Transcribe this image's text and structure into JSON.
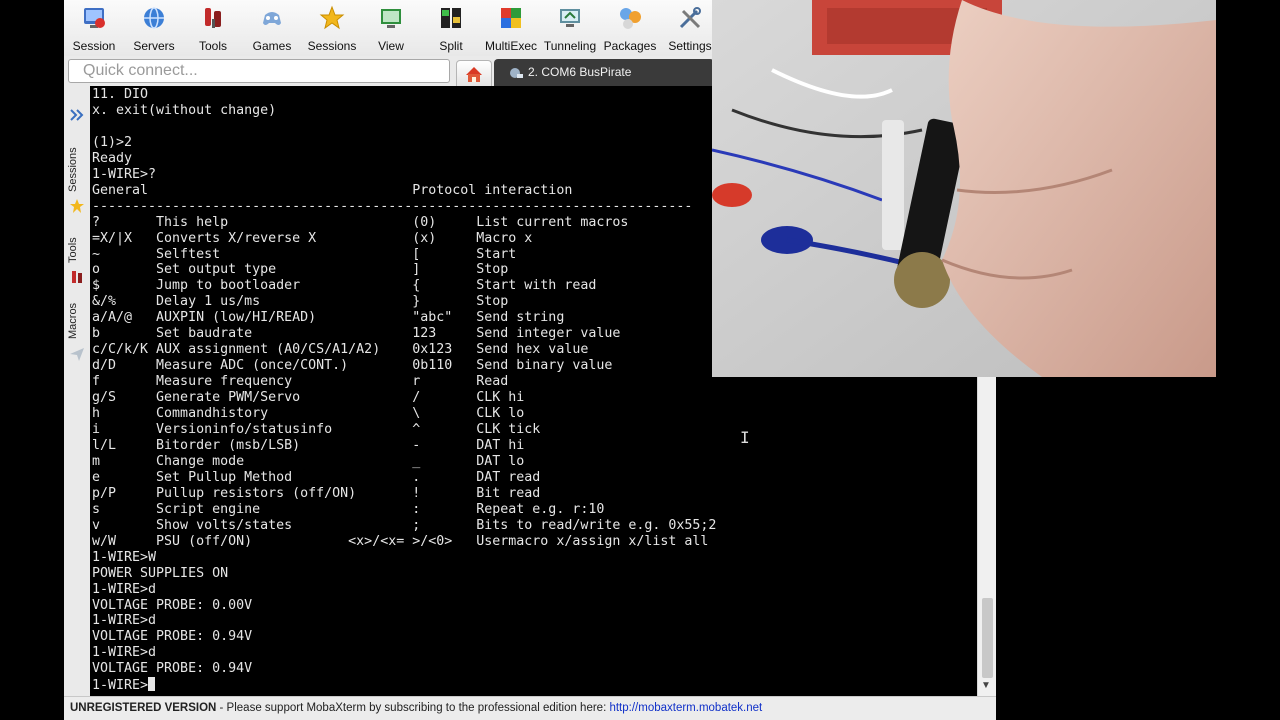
{
  "toolbar": {
    "buttons": [
      {
        "label": "Session",
        "icon": "session-icon"
      },
      {
        "label": "Servers",
        "icon": "servers-icon"
      },
      {
        "label": "Tools",
        "icon": "tools-icon"
      },
      {
        "label": "Games",
        "icon": "games-icon"
      },
      {
        "label": "Sessions",
        "icon": "sessions-star-icon"
      },
      {
        "label": "View",
        "icon": "view-icon"
      },
      {
        "label": "Split",
        "icon": "split-icon"
      },
      {
        "label": "MultiExec",
        "icon": "multiexec-icon"
      },
      {
        "label": "Tunneling",
        "icon": "tunneling-icon"
      },
      {
        "label": "Packages",
        "icon": "packages-icon"
      },
      {
        "label": "Settings",
        "icon": "settings-icon"
      }
    ]
  },
  "quick_connect": {
    "placeholder": "Quick connect..."
  },
  "tabs": {
    "home_icon": "home-icon",
    "active": {
      "label": "2. COM6 BusPirate",
      "icon": "serial-session-icon"
    }
  },
  "sidebar": {
    "tabs": [
      {
        "label": "Sessions",
        "icon": "star-icon"
      },
      {
        "label": "Tools",
        "icon": "tools-icon"
      },
      {
        "label": "Macros",
        "icon": "send-icon"
      }
    ]
  },
  "terminal": {
    "lines": [
      "11. DIO",
      "x. exit(without change)",
      "",
      "(1)>2",
      "Ready",
      "1-WIRE>?",
      "General                                 Protocol interaction",
      "---------------------------------------------------------------------------",
      "?       This help                       (0)     List current macros",
      "=X/|X   Converts X/reverse X            (x)     Macro x",
      "~       Selftest                        [       Start",
      "o       Set output type                 ]       Stop",
      "$       Jump to bootloader              {       Start with read",
      "&/%     Delay 1 us/ms                   }       Stop",
      "a/A/@   AUXPIN (low/HI/READ)            \"abc\"   Send string",
      "b       Set baudrate                    123     Send integer value",
      "c/C/k/K AUX assignment (A0/CS/A1/A2)    0x123   Send hex value",
      "d/D     Measure ADC (once/CONT.)        0b110   Send binary value",
      "f       Measure frequency               r       Read",
      "g/S     Generate PWM/Servo              /       CLK hi",
      "h       Commandhistory                  \\       CLK lo",
      "i       Versioninfo/statusinfo          ^       CLK tick",
      "l/L     Bitorder (msb/LSB)              -       DAT hi",
      "m       Change mode                     _       DAT lo",
      "e       Set Pullup Method               .       DAT read",
      "p/P     Pullup resistors (off/ON)       !       Bit read",
      "s       Script engine                   :       Repeat e.g. r:10",
      "v       Show volts/states               ;       Bits to read/write e.g. 0x55;2",
      "w/W     PSU (off/ON)            <x>/<x= >/<0>   Usermacro x/assign x/list all",
      "1-WIRE>W",
      "POWER SUPPLIES ON",
      "1-WIRE>d",
      "VOLTAGE PROBE: 0.00V",
      "1-WIRE>d",
      "VOLTAGE PROBE: 0.94V",
      "1-WIRE>d",
      "VOLTAGE PROBE: 0.94V",
      "1-WIRE>"
    ]
  },
  "statusbar": {
    "strong": "UNREGISTERED VERSION",
    "text": " -  Please support MobaXterm by subscribing to the professional edition here:  ",
    "link": "http://mobaxterm.mobatek.net"
  },
  "colors": {
    "terminal_bg": "#000000",
    "terminal_fg": "#e6e6e6",
    "link": "#1030c8",
    "tab_active": "#3a3a3a"
  }
}
